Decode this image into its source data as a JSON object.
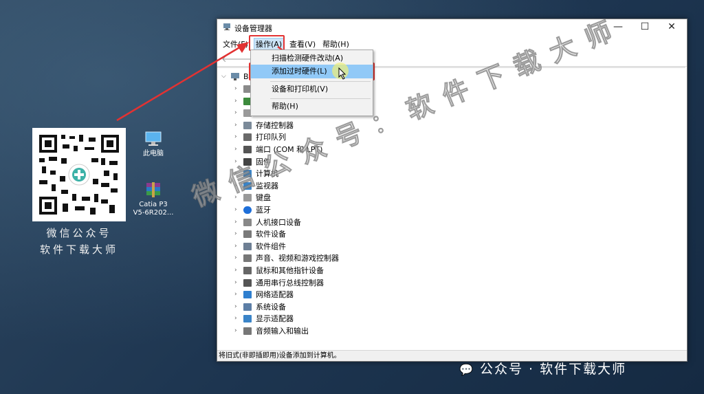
{
  "qr": {
    "caption_line1": "微信公众号",
    "caption_line2": "软件下载大师"
  },
  "desktop_icons": [
    {
      "name": "this-pc-icon",
      "label": "此电脑"
    },
    {
      "name": "winrar-archive-icon",
      "label": "Catia P3\nV5-6R202..."
    }
  ],
  "window": {
    "title": "设备管理器",
    "controls": {
      "minimize": "—",
      "maximize": "☐",
      "close": "✕"
    },
    "menu": [
      "文件(F)",
      "操作(A)",
      "查看(V)",
      "帮助(H)"
    ],
    "active_menu": "操作(A)",
    "nav": {
      "back": "🡐",
      "forward": "🡒"
    },
    "root_label": "B",
    "tree": [
      {
        "label": "",
        "icon": "cpu"
      },
      {
        "label": "",
        "icon": "monitor-green"
      },
      {
        "label": "",
        "icon": "drive"
      },
      {
        "label": "存储控制器",
        "icon": "storage"
      },
      {
        "label": "打印队列",
        "icon": "printer"
      },
      {
        "label": "端口 (COM 和 LPT)",
        "icon": "port"
      },
      {
        "label": "固件",
        "icon": "firmware"
      },
      {
        "label": "计算机",
        "icon": "computer"
      },
      {
        "label": "监视器",
        "icon": "monitor"
      },
      {
        "label": "键盘",
        "icon": "keyboard"
      },
      {
        "label": "蓝牙",
        "icon": "bluetooth"
      },
      {
        "label": "人机接口设备",
        "icon": "hid"
      },
      {
        "label": "软件设备",
        "icon": "software"
      },
      {
        "label": "软件组件",
        "icon": "component"
      },
      {
        "label": "声音、视频和游戏控制器",
        "icon": "sound"
      },
      {
        "label": "鼠标和其他指针设备",
        "icon": "mouse"
      },
      {
        "label": "通用串行总线控制器",
        "icon": "usb"
      },
      {
        "label": "网络适配器",
        "icon": "network"
      },
      {
        "label": "系统设备",
        "icon": "system"
      },
      {
        "label": "显示适配器",
        "icon": "display"
      },
      {
        "label": "音频输入和输出",
        "icon": "audio"
      }
    ],
    "status": "将旧式(非即插即用)设备添加到计算机。"
  },
  "dropdown": {
    "items": [
      {
        "label": "扫描检测硬件改动(A)"
      },
      {
        "label": "添加过时硬件(L)",
        "highlighted": true
      },
      {
        "label": "设备和打印机(V)"
      },
      {
        "label": "帮助(H)"
      }
    ]
  },
  "watermark": {
    "text": "微信公众号：软件下载大师"
  },
  "bottom_mark": {
    "text": "公众号 · 软件下载大师"
  },
  "colors": {
    "highlight": "#91c9f7",
    "annotation_red": "#e23232"
  }
}
